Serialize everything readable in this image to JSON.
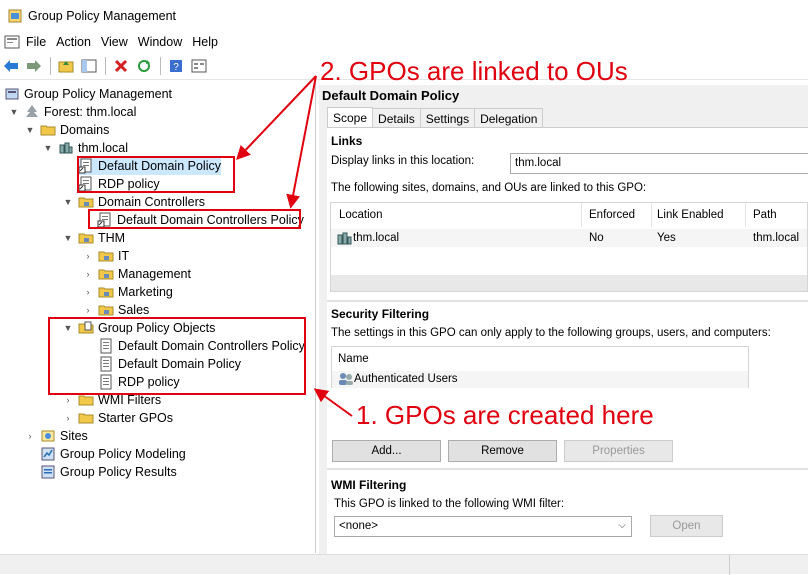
{
  "window": {
    "title": "Group Policy Management"
  },
  "menu": {
    "file": "File",
    "action": "Action",
    "view": "View",
    "window": "Window",
    "help": "Help"
  },
  "tree": {
    "root": "Group Policy Management",
    "forest": "Forest: thm.local",
    "domains": "Domains",
    "domain": "thm.local",
    "ddp": "Default Domain Policy",
    "rdp": "RDP policy",
    "dc_ou": "Domain Controllers",
    "ddcp": "Default Domain Controllers Policy",
    "thm": "THM",
    "it": "IT",
    "mgmt": "Management",
    "marketing": "Marketing",
    "sales": "Sales",
    "gpo": "Group Policy Objects",
    "gpo_ddcp": "Default Domain Controllers Policy",
    "gpo_ddp": "Default Domain Policy",
    "gpo_rdp": "RDP policy",
    "wmi": "WMI Filters",
    "starter": "Starter GPOs",
    "sites": "Sites",
    "modeling": "Group Policy Modeling",
    "results": "Group Policy Results"
  },
  "details": {
    "title": "Default Domain Policy",
    "tabs": [
      "Scope",
      "Details",
      "Settings",
      "Delegation"
    ],
    "links_heading": "Links",
    "display_links_label": "Display links in this location:",
    "display_links_value": "thm.local",
    "links_desc": "The following sites, domains, and OUs are linked to this GPO:",
    "links_columns": [
      "Location",
      "Enforced",
      "Link Enabled",
      "Path"
    ],
    "links_row": {
      "location": "thm.local",
      "enforced": "No",
      "enabled": "Yes",
      "path": "thm.local"
    },
    "security_heading": "Security Filtering",
    "security_desc": "The settings in this GPO can only apply to the following groups, users, and computers:",
    "security_column": "Name",
    "security_row": "Authenticated Users",
    "add_button": "Add...",
    "remove_button": "Remove",
    "properties_button": "Properties",
    "wmi_heading": "WMI Filtering",
    "wmi_desc": "This GPO is linked to the following WMI filter:",
    "wmi_value": "<none>",
    "open_button": "Open"
  },
  "annotations": {
    "linked": "2. GPOs are linked to OUs",
    "created": "1. GPOs are created here",
    "color": "#e0000f"
  }
}
